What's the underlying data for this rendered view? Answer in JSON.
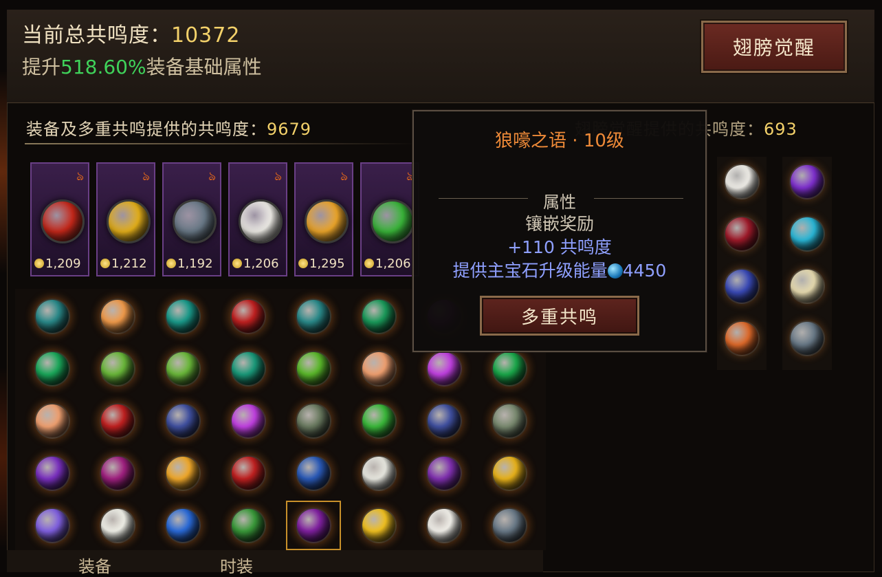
{
  "header": {
    "total_label": "当前总共鸣度：",
    "total_value": "10372",
    "boost_prefix": "提升",
    "boost_value": "518.60%",
    "boost_suffix": "装备基础属性",
    "wake_button": "翅膀觉醒"
  },
  "sub": {
    "left_label": "装备及多重共鸣提供的共鸣度：",
    "left_value": "9679",
    "right_label": "翅膀觉醒提供的共鸣度：",
    "right_value": "693"
  },
  "cards": [
    {
      "tag": "ঌ",
      "value": "1,209",
      "color": "#c8281a"
    },
    {
      "tag": "ঌ",
      "value": "1,212",
      "color": "#e8b21a"
    },
    {
      "tag": "ঌ",
      "value": "1,192",
      "color": "#6a7a88"
    },
    {
      "tag": "ঌ",
      "value": "1,206",
      "color": "#f2f0ea"
    },
    {
      "tag": "ঌ",
      "value": "1,295",
      "color": "#f0a82a"
    },
    {
      "tag": "ঌ",
      "value": "1,206",
      "color": "#3ab83a"
    }
  ],
  "gem_grid": [
    [
      "#2a8a8a",
      "#f09a4a",
      "#1a9a8a",
      "#c02020",
      "#2a8a8a",
      "#1a9a5a",
      "#a020c0",
      "#1a9a4a"
    ],
    [
      "#1aa85a",
      "#6ab83a",
      "#6ab83a",
      "#1a9a7a",
      "#5ab82a",
      "#f0a070",
      "#c040e0",
      "#1aa84a"
    ],
    [
      "#f0a070",
      "#c02020",
      "#4050a0",
      "#c040e0",
      "#6a7a60",
      "#3ab83a",
      "#4050a0",
      "#7a8a70"
    ],
    [
      "#7a30c0",
      "#a02080",
      "#f0a82a",
      "#c02020",
      "#2a5ab8",
      "#e8e8e0",
      "#8030b0",
      "#e8b21a"
    ],
    [
      "#8060e0",
      "#f0f0e8",
      "#2a6ad8",
      "#3a9a3a",
      "#8020a0",
      "#f0c020",
      "#f2f0ea",
      "#6a7a88"
    ]
  ],
  "right_gems": [
    [
      "#f2f0ea",
      "#8030d0"
    ],
    [
      "#a01a2a",
      "#2ab8d8"
    ],
    [
      "#3a4ab8",
      "#e8dcb0"
    ],
    [
      "#e06a2a",
      "#6a7a88"
    ]
  ],
  "tooltip": {
    "title": "狼嚎之语 · 10级",
    "section": "属性",
    "reward": "镶嵌奖励",
    "resonance": "+110 共鸣度",
    "energy_label": "提供主宝石升级能量",
    "energy_value": "4450",
    "button": "多重共鸣"
  },
  "tabs": [
    "装备",
    "时装"
  ]
}
